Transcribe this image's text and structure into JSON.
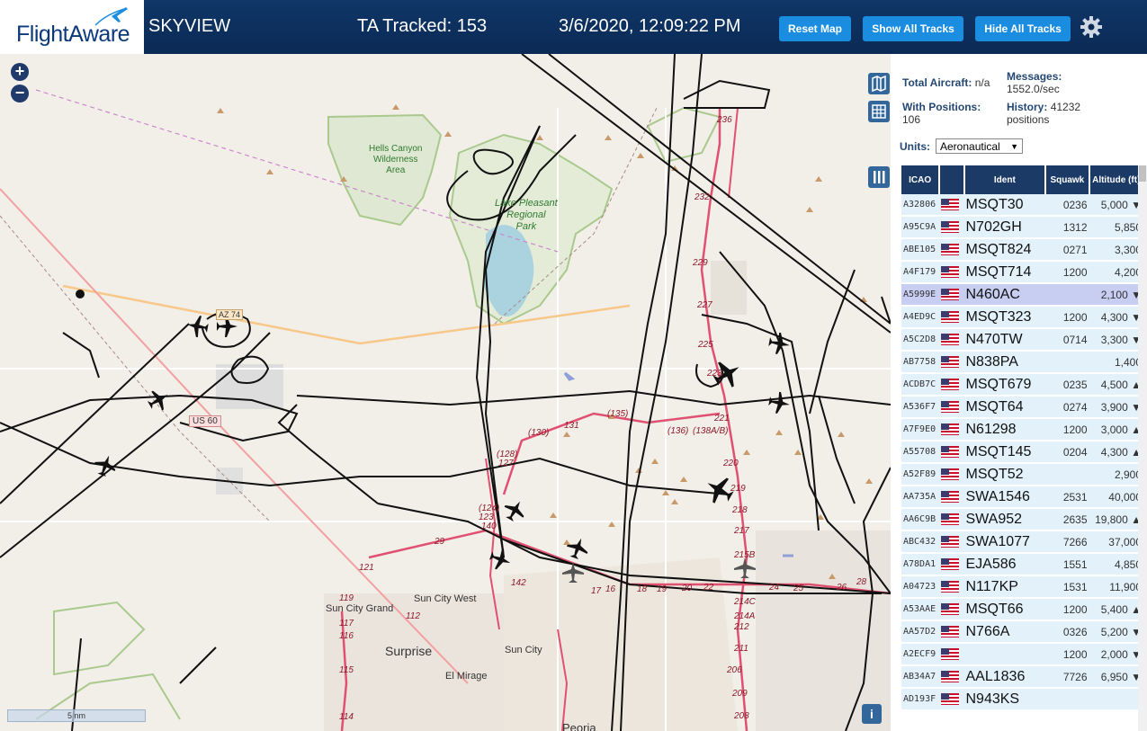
{
  "header": {
    "logo_text": "FlightAware",
    "title": "SKYVIEW",
    "tracked": "TA Tracked: 153",
    "datetime": "3/6/2020, 12:09:22 PM",
    "buttons": {
      "reset": "Reset Map",
      "show_all": "Show All Tracks",
      "hide_all": "Hide All Tracks"
    }
  },
  "map": {
    "zoom_in": "+",
    "zoom_out": "−",
    "labels": {
      "hells_canyon": "Hells Canyon\nWilderness\nArea",
      "lake_pleasant": "Lake Pleasant\nRegional\nPark",
      "sun_city_west": "Sun City West",
      "sun_city_grand": "Sun City Grand",
      "surprise": "Surprise",
      "sun_city": "Sun City",
      "el_mirage": "El Mirage",
      "peoria": "Peoria",
      "az74": "AZ 74",
      "us60": "US 60"
    },
    "route_numbers": [
      "236",
      "232",
      "229",
      "227",
      "225",
      "223",
      "221",
      "220",
      "219",
      "218",
      "217",
      "215B",
      "214C",
      "214A",
      "212",
      "211",
      "209",
      "208",
      "206",
      "(135)",
      "(136)",
      "(138A/B)",
      "131",
      "(130)",
      "(128)",
      "127",
      "(124)",
      "17",
      "16",
      "18",
      "19",
      "20",
      "22",
      "24",
      "25",
      "26",
      "28",
      "29",
      "123",
      "121",
      "119",
      "117",
      "116",
      "115",
      "114",
      "112",
      "142",
      "140",
      "122"
    ],
    "scale_label": "5 nm",
    "info_label": "i"
  },
  "stats": {
    "total_label": "Total Aircraft:",
    "total_value": "n/a",
    "messages_label": "Messages:",
    "messages_value": "1552.0/sec",
    "positions_label": "With Positions:",
    "positions_value": "106",
    "history_label": "History:",
    "history_value": "41232",
    "history_unit": "positions",
    "units_label": "Units:",
    "units_value": "Aeronautical"
  },
  "table": {
    "headers": {
      "icao": "ICAO",
      "ident": "Ident",
      "squawk": "Squawk",
      "altitude": "Altitude (ft)"
    },
    "rows": [
      {
        "icao": "A32806",
        "ident": "MSQT30",
        "squawk": "0236",
        "alt": "5,000 ▼"
      },
      {
        "icao": "A95C9A",
        "ident": "N702GH",
        "squawk": "1312",
        "alt": "5,850"
      },
      {
        "icao": "ABE105",
        "ident": "MSQT824",
        "squawk": "0271",
        "alt": "3,300"
      },
      {
        "icao": "A4F179",
        "ident": "MSQT714",
        "squawk": "1200",
        "alt": "4,200"
      },
      {
        "icao": "A5999E",
        "ident": "N460AC",
        "squawk": "",
        "alt": "2,100 ▼"
      },
      {
        "icao": "A4ED9C",
        "ident": "MSQT323",
        "squawk": "1200",
        "alt": "4,300 ▼"
      },
      {
        "icao": "A5C2D8",
        "ident": "N470TW",
        "squawk": "0714",
        "alt": "3,300 ▼"
      },
      {
        "icao": "AB7758",
        "ident": "N838PA",
        "squawk": "",
        "alt": "1,400"
      },
      {
        "icao": "ACDB7C",
        "ident": "MSQT679",
        "squawk": "0235",
        "alt": "4,500 ▲"
      },
      {
        "icao": "A536F7",
        "ident": "MSQT64",
        "squawk": "0274",
        "alt": "3,900 ▼"
      },
      {
        "icao": "A7F9E0",
        "ident": "N61298",
        "squawk": "1200",
        "alt": "3,000 ▲"
      },
      {
        "icao": "A55708",
        "ident": "MSQT145",
        "squawk": "0204",
        "alt": "4,300 ▲"
      },
      {
        "icao": "A52F89",
        "ident": "MSQT52",
        "squawk": "",
        "alt": "2,900"
      },
      {
        "icao": "AA735A",
        "ident": "SWA1546",
        "squawk": "2531",
        "alt": "40,000"
      },
      {
        "icao": "AA6C9B",
        "ident": "SWA952",
        "squawk": "2635",
        "alt": "19,800 ▲"
      },
      {
        "icao": "ABC432",
        "ident": "SWA1077",
        "squawk": "7266",
        "alt": "37,000"
      },
      {
        "icao": "A78DA1",
        "ident": "EJA586",
        "squawk": "1551",
        "alt": "4,850"
      },
      {
        "icao": "A04723",
        "ident": "N117KP",
        "squawk": "1531",
        "alt": "11,900"
      },
      {
        "icao": "A53AAE",
        "ident": "MSQT66",
        "squawk": "1200",
        "alt": "5,400 ▲"
      },
      {
        "icao": "AA57D2",
        "ident": "N766A",
        "squawk": "0326",
        "alt": "5,200 ▼"
      },
      {
        "icao": "A2ECF9",
        "ident": "",
        "squawk": "1200",
        "alt": "2,000 ▼"
      },
      {
        "icao": "AB34A7",
        "ident": "AAL1836",
        "squawk": "7726",
        "alt": "6,950 ▼"
      },
      {
        "icao": "AD193F",
        "ident": "N943KS",
        "squawk": "",
        "alt": ""
      }
    ]
  },
  "colors": {
    "header_bg": "#0b2a55",
    "button": "#1a8de0",
    "table_header": "#1b3a66",
    "row": "#e3f1fb",
    "selected": "#c8cdf2",
    "route": "#e05070"
  }
}
